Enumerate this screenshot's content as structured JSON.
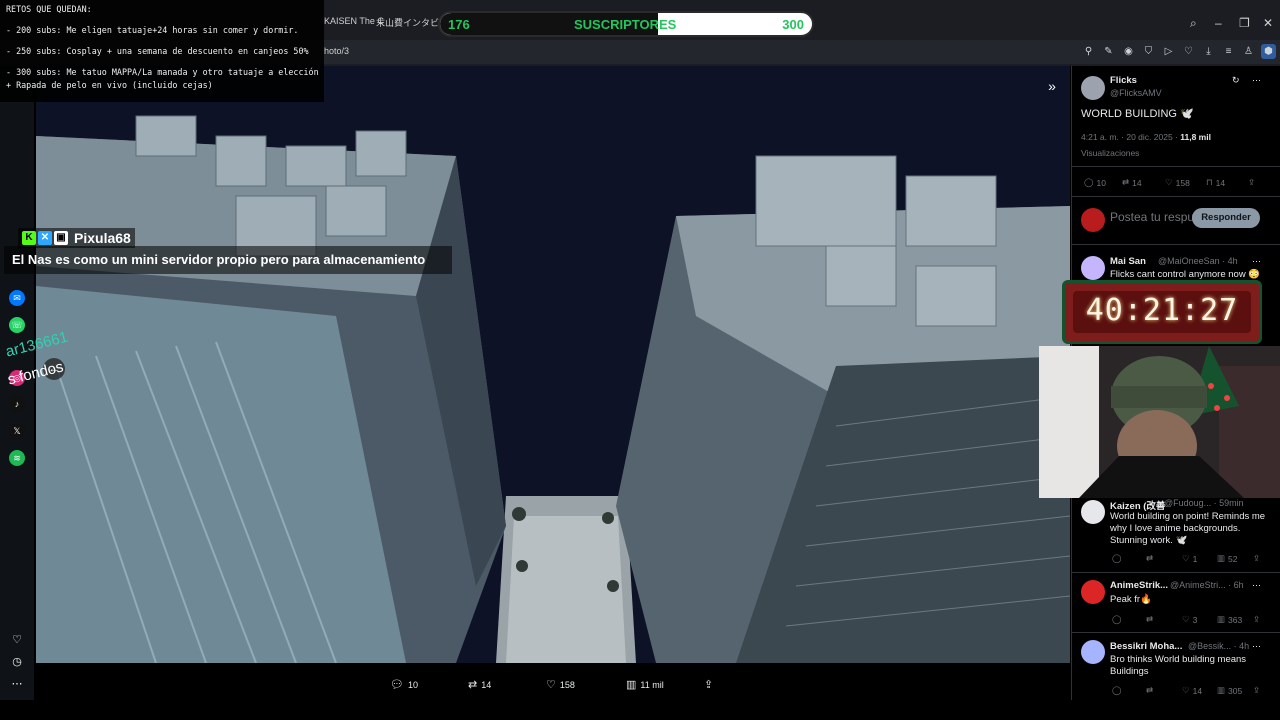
{
  "browser": {
    "tabs": [
      "KAISEN The C",
      "末山費インタビ"
    ],
    "url": "hoto/3",
    "toolbar_icons": [
      "zoom-icon",
      "edit-icon",
      "camera-icon",
      "shield-icon",
      "play-icon",
      "heart-icon",
      "download-icon",
      "menu-icon",
      "user-icon",
      "extension-icon"
    ]
  },
  "retos": {
    "title": "RETOS QUE QUEDAN:",
    "items": [
      "- 200 subs: Me eligen tatuaje+24 horas sin comer y dormir.",
      "- 250 subs: Cosplay + una semana de descuento en canjeos 50%",
      "- 300 subs: Me tatuo MAPPA/La manada y otro tatuaje a elección",
      "+ Rapada de pelo en vivo (incluido cejas)"
    ]
  },
  "subs_bar": {
    "current": "176",
    "label": "SUSCRIPTORES",
    "goal": "300",
    "progress": 0.587,
    "color": "#22c55e"
  },
  "chat": {
    "username": "Pixula68",
    "message": "El Nas es como un mini servidor propio pero para almacenamiento",
    "rotated_1": "ar136661",
    "rotated_2": "s fondos"
  },
  "media_actions": {
    "replies": "10",
    "reposts": "14",
    "likes": "158",
    "views": "11 mil"
  },
  "tweet": {
    "name": "Flicks",
    "handle": "@FlicksAMV",
    "text": "WORLD BUILDING 🕊️",
    "time": "4:21 a. m. · 20 dic. 2025 · ",
    "views_count": "11,8 mil",
    "views_label": "Visualizaciones",
    "replies": "10",
    "reposts": "14",
    "likes": "158",
    "bookmarks": "14"
  },
  "reply_box": {
    "placeholder": "Postea tu respuesta",
    "button": "Responder"
  },
  "replies": [
    {
      "name": "Mai San",
      "handle": "@MaiOneeSan · 4h",
      "text": "Flicks cant control anymore now 😳"
    },
    {
      "name": "Kaizen (改善",
      "handle": "@Fudoug... · 59min",
      "text": "World building on point! Reminds me why I love anime backgrounds. Stunning work. 🕊️",
      "replies": "",
      "reposts": "",
      "likes": "1",
      "views": "52"
    },
    {
      "name": "AnimeStrik...",
      "handle": "@AnimeStri... · 6h",
      "text": "Peak fr🔥",
      "replies": "",
      "reposts": "",
      "likes": "3",
      "views": "363"
    },
    {
      "name": "Bessikri Moha...",
      "handle": "@Bessik... · 4h",
      "text": "Bro thinks World building means Buildings",
      "replies": "",
      "reposts": "",
      "likes": "14",
      "views": "305"
    }
  ],
  "timer": {
    "value": "40:21:27"
  },
  "colors": {
    "accent_green": "#22c55e",
    "twitter_bg": "#000000",
    "muted": "#71767b"
  }
}
